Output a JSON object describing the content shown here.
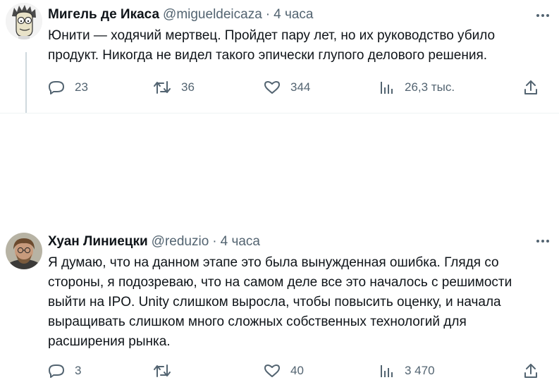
{
  "tweets": [
    {
      "author_name": "Мигель де Икаса",
      "handle": "@migueldeicaza",
      "separator": "·",
      "time": "4 часа",
      "text": "Юнити — ходячий мертвец. Пройдет пару лет, но их руководство убило продукт. Никогда не видел такого эпически глупого делового решения.",
      "replies": "23",
      "retweets": "36",
      "likes": "344",
      "views": "26,3 тыс."
    },
    {
      "author_name": "Хуан Линиецки",
      "handle": "@reduzio",
      "separator": "·",
      "time": "4 часа",
      "text": "Я думаю, что на данном этапе это была вынужденная ошибка. Глядя со стороны, я подозреваю, что на самом деле все это началось с решимости выйти на IPO. Unity слишком выросла, чтобы повысить оценку, и начала выращивать слишком много сложных собственных технологий для расширения рынка.",
      "replies": "3",
      "retweets": "",
      "likes": "40",
      "views": "3 470"
    }
  ],
  "icons": [
    "reply-icon",
    "retweet-icon",
    "like-icon",
    "views-icon",
    "share-icon",
    "more-icon"
  ],
  "colors": {
    "text": "#0f1419",
    "secondary": "#536471",
    "divider": "#eff3f4",
    "thread_line": "#cfd9de"
  }
}
